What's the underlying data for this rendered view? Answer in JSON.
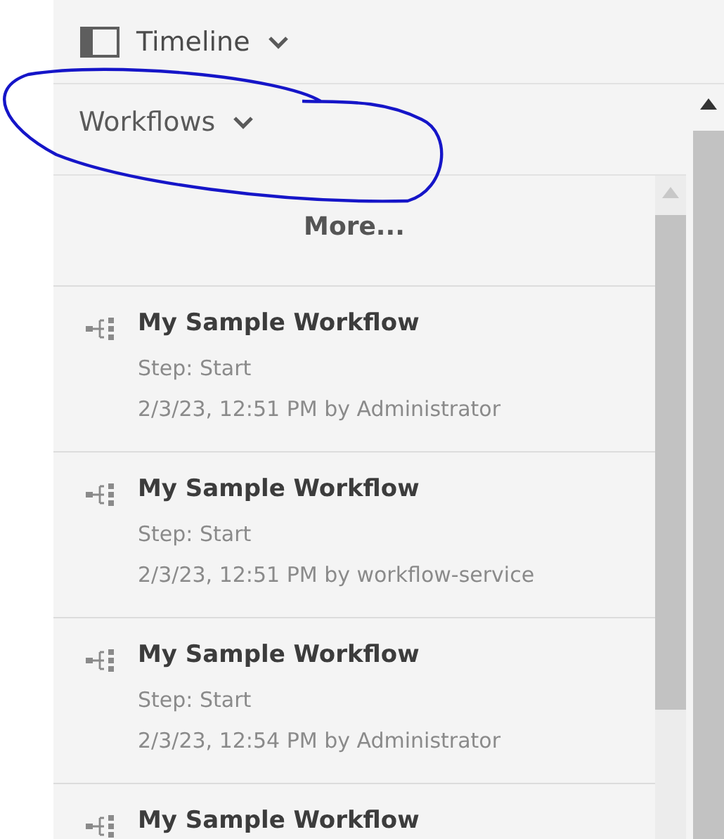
{
  "header": {
    "title": "Timeline"
  },
  "section": {
    "title": "Workflows"
  },
  "more_link": "More...",
  "items": [
    {
      "title": "My Sample Workflow",
      "step": "Step: Start",
      "meta": "2/3/23, 12:51 PM by Administrator"
    },
    {
      "title": "My Sample Workflow",
      "step": "Step: Start",
      "meta": "2/3/23, 12:51 PM by workflow-service"
    },
    {
      "title": "My Sample Workflow",
      "step": "Step: Start",
      "meta": "2/3/23, 12:54 PM by Administrator"
    },
    {
      "title": "My Sample Workflow"
    }
  ]
}
